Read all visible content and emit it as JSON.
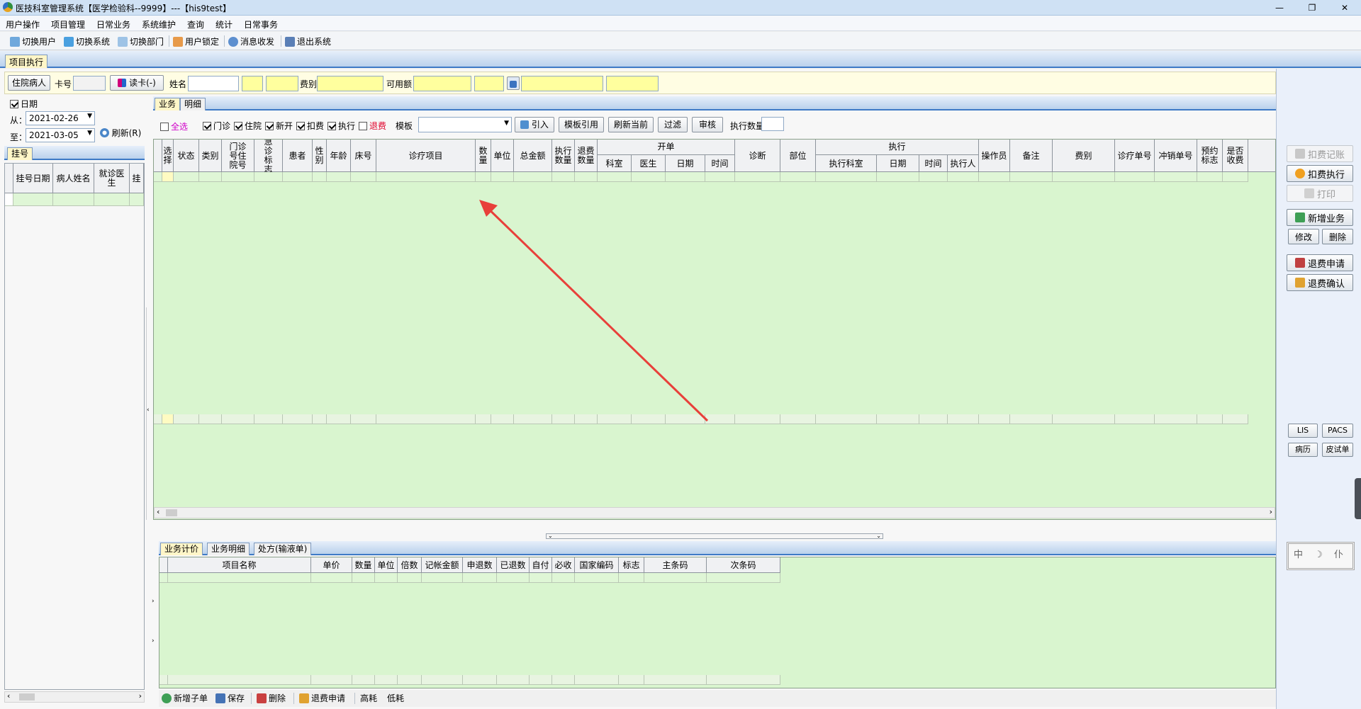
{
  "window": {
    "title": "医技科室管理系统【医学检验科--9999】---【his9test】",
    "min": "—",
    "restore": "❐",
    "close": "✕"
  },
  "menu": [
    "用户操作",
    "项目管理",
    "日常业务",
    "系统维护",
    "查询",
    "统计",
    "日常事务"
  ],
  "toolbar": [
    "切换用户",
    "切换系统",
    "切换部门",
    "用户锁定",
    "消息收发",
    "退出系统"
  ],
  "module_tab": "项目执行",
  "header": {
    "patient_button": "住院病人",
    "card_label": "卡号",
    "read_card": "读卡(-)",
    "name_label": "姓名",
    "fee_type_label": "费别",
    "available_label": "可用额"
  },
  "left": {
    "date_label": "日期",
    "from_label": "从：",
    "from_date": "2021-02-26",
    "to_label": "至：",
    "to_date": "2021-03-05",
    "refresh": "刷新(R)",
    "tab": "挂号",
    "columns": [
      "挂号日期",
      "病人姓名",
      "就诊医生",
      "挂"
    ]
  },
  "biz_tabs": [
    "业务",
    "明细"
  ],
  "filters": {
    "select_all": "全选",
    "outpatient": "门诊",
    "inpatient": "住院",
    "new_open": "新开",
    "deduct": "扣费",
    "execute": "执行",
    "refund": "退费",
    "template_label": "模板",
    "import": "引入",
    "template_ref": "模板引用",
    "refresh_current": "刷新当前",
    "filter": "过滤",
    "audit": "审核",
    "exec_count_label": "执行数量"
  },
  "main_grid": {
    "columns": [
      "选择",
      "状态",
      "类别",
      "门诊号住院号",
      "急诊标志",
      "患者",
      "性别",
      "年龄",
      "床号",
      "诊疗项目",
      "数量",
      "单位",
      "总金额",
      "执行数量",
      "退费数量",
      "科室",
      "医生",
      "日期",
      "时间",
      "诊断",
      "部位",
      "执行科室",
      "日期",
      "时间",
      "执行人",
      "操作员",
      "备注",
      "费别",
      "诊疗单号",
      "冲销单号",
      "预约标志",
      "是否收费"
    ],
    "group_kaidan": "开单",
    "group_zhixing": "执行"
  },
  "bottom_tabs": [
    "业务计价",
    "业务明细",
    "处方(输液单)"
  ],
  "bottom_grid": {
    "columns": [
      "项目名称",
      "单价",
      "数量",
      "单位",
      "倍数",
      "记帐金额",
      "申退数",
      "已退数",
      "自付",
      "必收",
      "国家编码",
      "标志",
      "主条码",
      "次条码"
    ]
  },
  "bottom_toolbar": [
    "新增子单",
    "保存",
    "删除",
    "退费申请",
    "高耗",
    "低耗"
  ],
  "right": {
    "deduct_record": "扣费记账",
    "deduct_execute": "扣费执行",
    "print": "打印",
    "new_business": "新增业务",
    "modify": "修改",
    "delete": "删除",
    "refund_apply": "退费申请",
    "refund_confirm": "退费确认",
    "lis": "LIS",
    "pacs": "PACS",
    "medical_record": "病历",
    "skin_test": "皮试单",
    "ime": "中 ☽ 仆"
  },
  "colors": {
    "grid_bg": "#d9f5cf",
    "header_bg": "#fffde3",
    "accent": "#3e7ac6",
    "refund_red": "#e0002a",
    "select_all": "#d000c8",
    "arrow": "#e8403a"
  }
}
